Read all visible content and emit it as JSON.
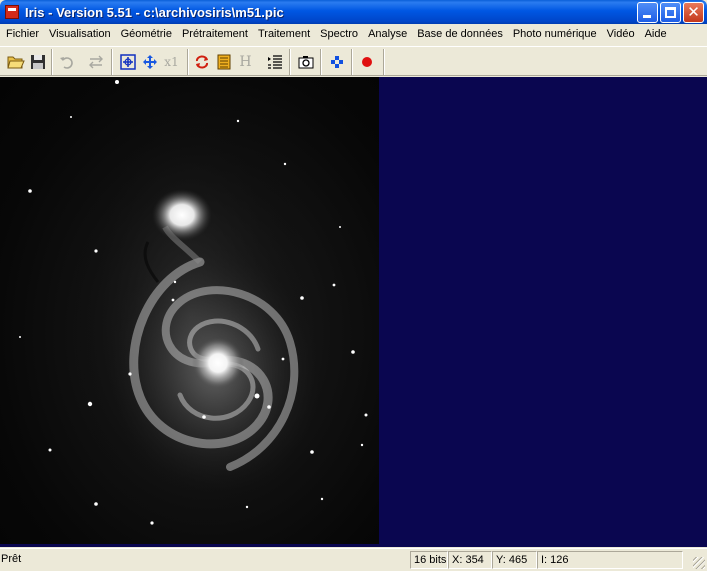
{
  "window": {
    "title": "Iris - Version 5.51 - c:\\archivosiris\\m51.pic",
    "close_glyph": "✕"
  },
  "menu": {
    "items": [
      "Fichier",
      "Visualisation",
      "Géométrie",
      "Prétraitement",
      "Traitement",
      "Spectro",
      "Analyse",
      "Base de données",
      "Photo numérique",
      "Vidéo",
      "Aide"
    ]
  },
  "toolbar": {
    "buttons": [
      {
        "name": "open-folder-icon"
      },
      {
        "name": "save-icon"
      },
      {
        "name": "undo-icon"
      },
      {
        "name": "flip-icon"
      },
      {
        "name": "zoom-window-icon"
      },
      {
        "name": "move-icon"
      },
      {
        "name": "zoom-x1-icon",
        "label": "x1"
      },
      {
        "name": "refresh-icon"
      },
      {
        "name": "threshold-icon"
      },
      {
        "name": "header-icon",
        "label": "H"
      },
      {
        "name": "list-icon"
      },
      {
        "name": "camera-icon"
      },
      {
        "name": "stars-icon"
      },
      {
        "name": "record-icon"
      }
    ]
  },
  "status": {
    "main": "Prêt",
    "bits": "16 bits",
    "x": "X: 354",
    "y": "Y: 465",
    "intensity": "I: 126"
  },
  "colors": {
    "workspace": "#0a0650",
    "image_bg": "#080808",
    "title_bar": "#0057e3"
  }
}
